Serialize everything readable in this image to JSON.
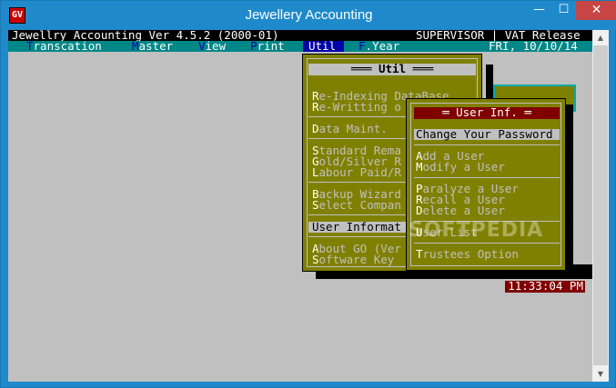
{
  "window": {
    "title": "Jewellery Accounting",
    "icon_glyph": "GV",
    "min_glyph": "—",
    "max_glyph": "☐",
    "close_glyph": "✕"
  },
  "header": {
    "left": "Jewellry Accounting Ver 4.5.2 (2000-01)",
    "right": "SUPERVISOR | VAT Release"
  },
  "menubar": {
    "items": [
      {
        "hotkey": "T",
        "rest": "ranscation"
      },
      {
        "hotkey": "M",
        "rest": "aster"
      },
      {
        "hotkey": "V",
        "rest": "iew"
      },
      {
        "hotkey": "P",
        "rest": "rint"
      },
      {
        "hotkey": "U",
        "rest": "til"
      },
      {
        "hotkey": "F",
        "rest": ".Year"
      }
    ],
    "date": "FRI, 10/10/14"
  },
  "util_menu": {
    "title": "═══ Util ═══",
    "items": [
      {
        "hotkey": "R",
        "rest": "e-Indexing DataBase"
      },
      {
        "hotkey": "R",
        "rest": "e-Writting o"
      },
      {
        "hotkey": "D",
        "rest": "ata Maint."
      },
      {
        "hotkey": "S",
        "rest": "tandard Rema"
      },
      {
        "hotkey": "G",
        "rest": "old/Silver R"
      },
      {
        "hotkey": "L",
        "rest": "abour Paid/R"
      },
      {
        "hotkey": "B",
        "rest": "ackup Wizard"
      },
      {
        "hotkey": "S",
        "rest": "elect Compan"
      },
      {
        "hotkey": "U",
        "rest": "ser Informat"
      },
      {
        "hotkey": "A",
        "rest": "bout GO (Ver"
      },
      {
        "hotkey": "S",
        "rest": "oftware Key"
      }
    ]
  },
  "user_menu": {
    "title": "═ User Inf. ═",
    "items": [
      {
        "hotkey": "C",
        "rest": "hange Your Password"
      },
      {
        "hotkey": "A",
        "rest": "dd a User"
      },
      {
        "hotkey": "M",
        "rest": "odify a User"
      },
      {
        "hotkey": "P",
        "rest": "aralyze a User"
      },
      {
        "hotkey": "R",
        "rest": "ecall a User"
      },
      {
        "hotkey": "D",
        "rest": "elete a User"
      },
      {
        "hotkey": "U",
        "rest": "ser List"
      },
      {
        "hotkey": "T",
        "rest": "rustees Option"
      }
    ]
  },
  "clock": "11:33:04 PM",
  "watermark": "SOFTPEDIA",
  "scrollbar": {
    "up_glyph": "▲",
    "down_glyph": "▼"
  }
}
